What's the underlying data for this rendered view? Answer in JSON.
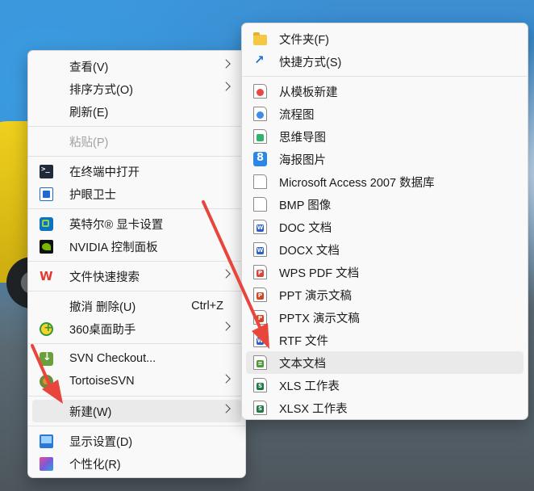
{
  "context_menu": {
    "items": [
      {
        "label": "查看(V)",
        "icon": "none",
        "submenu": true
      },
      {
        "label": "排序方式(O)",
        "icon": "none",
        "submenu": true
      },
      {
        "label": "刷新(E)",
        "icon": "none"
      },
      {
        "label": "粘贴(P)",
        "icon": "none",
        "disabled": true
      },
      {
        "label": "在终端中打开",
        "icon": "terminal-icon"
      },
      {
        "label": "护眼卫士",
        "icon": "eye-guard-icon"
      },
      {
        "label": "英特尔® 显卡设置",
        "icon": "intel-graphics-icon"
      },
      {
        "label": "NVIDIA 控制面板",
        "icon": "nvidia-icon"
      },
      {
        "label": "文件快速搜索",
        "icon": "wps-icon",
        "submenu": true
      },
      {
        "label": "撤消 删除(U)",
        "icon": "none",
        "shortcut": "Ctrl+Z"
      },
      {
        "label": "360桌面助手",
        "icon": "360-icon",
        "submenu": true
      },
      {
        "label": "SVN Checkout...",
        "icon": "svn-checkout-icon"
      },
      {
        "label": "TortoiseSVN",
        "icon": "tortoisesvn-icon",
        "submenu": true
      },
      {
        "label": "新建(W)",
        "icon": "none",
        "submenu": true,
        "highlighted": true
      },
      {
        "label": "显示设置(D)",
        "icon": "display-icon"
      },
      {
        "label": "个性化(R)",
        "icon": "personalize-icon"
      }
    ]
  },
  "new_submenu": {
    "items": [
      {
        "label": "文件夹(F)",
        "icon": "folder-icon"
      },
      {
        "label": "快捷方式(S)",
        "icon": "shortcut-icon"
      },
      {
        "label": "从模板新建",
        "icon": "template-icon"
      },
      {
        "label": "流程图",
        "icon": "flowchart-icon"
      },
      {
        "label": "思维导图",
        "icon": "mindmap-icon"
      },
      {
        "label": "海报图片",
        "icon": "poster-icon"
      },
      {
        "label": "Microsoft Access 2007 数据库",
        "icon": "blank-file-icon"
      },
      {
        "label": "BMP 图像",
        "icon": "blank-file-icon"
      },
      {
        "label": "DOC 文档",
        "icon": "word-doc-icon"
      },
      {
        "label": "DOCX 文档",
        "icon": "word-docx-icon"
      },
      {
        "label": "WPS PDF 文档",
        "icon": "wps-pdf-icon"
      },
      {
        "label": "PPT 演示文稿",
        "icon": "ppt-icon"
      },
      {
        "label": "PPTX 演示文稿",
        "icon": "pptx-icon"
      },
      {
        "label": "RTF 文件",
        "icon": "rtf-icon"
      },
      {
        "label": "文本文档",
        "icon": "text-doc-icon",
        "highlighted": true
      },
      {
        "label": "XLS 工作表",
        "icon": "xls-icon"
      },
      {
        "label": "XLSX 工作表",
        "icon": "xlsx-icon"
      }
    ]
  },
  "colors": {
    "highlight": "#eaeaea",
    "annotation_arrow": "#e8453c"
  }
}
